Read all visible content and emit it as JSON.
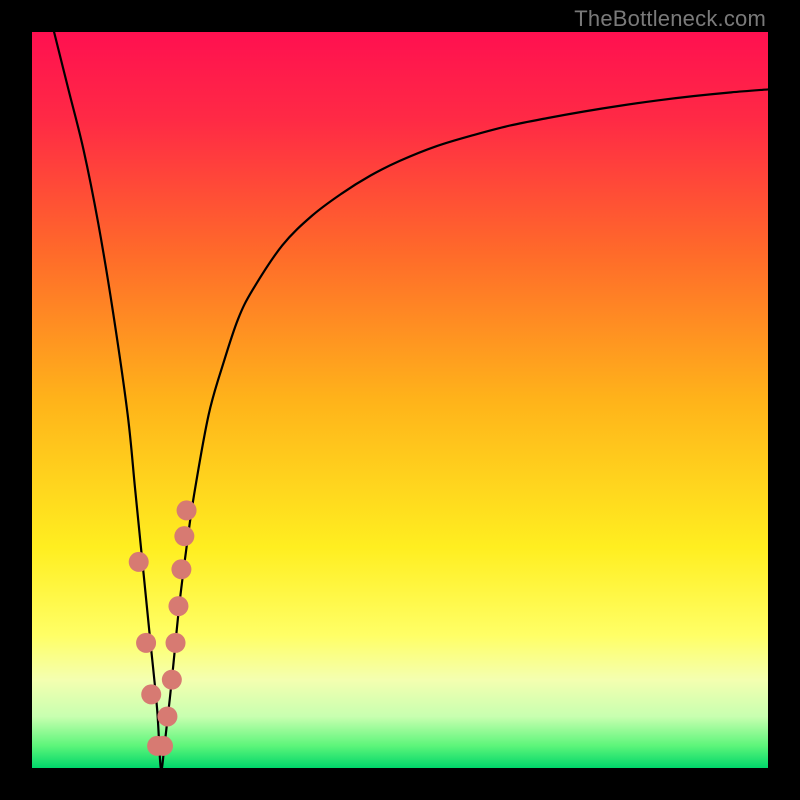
{
  "watermark": "TheBottleneck.com",
  "plot": {
    "inner_left": 32,
    "inner_top": 32,
    "inner_width": 736,
    "inner_height": 736
  },
  "colors": {
    "frame": "#000000",
    "curve": "#000000",
    "dot_fill": "#d77a72",
    "watermark": "#7a7a7a",
    "gradient_stops": [
      {
        "offset": 0.0,
        "color": "#ff1050"
      },
      {
        "offset": 0.12,
        "color": "#ff2a45"
      },
      {
        "offset": 0.3,
        "color": "#ff6a2a"
      },
      {
        "offset": 0.5,
        "color": "#ffb31a"
      },
      {
        "offset": 0.7,
        "color": "#ffee20"
      },
      {
        "offset": 0.82,
        "color": "#ffff66"
      },
      {
        "offset": 0.88,
        "color": "#f4ffb0"
      },
      {
        "offset": 0.93,
        "color": "#c8ffb0"
      },
      {
        "offset": 0.97,
        "color": "#5cf57a"
      },
      {
        "offset": 1.0,
        "color": "#00d66a"
      }
    ]
  },
  "chart_data": {
    "type": "line",
    "title": "",
    "xlabel": "",
    "ylabel": "",
    "xlim": [
      0,
      100
    ],
    "ylim": [
      0,
      100
    ],
    "x_min_at": 17.5,
    "series": [
      {
        "name": "bottleneck-curve",
        "x": [
          3,
          5,
          7,
          9,
          11,
          13,
          14,
          15,
          16,
          17,
          17.5,
          18,
          19,
          20,
          21,
          22,
          24,
          26,
          28,
          30,
          34,
          38,
          42,
          46,
          50,
          55,
          60,
          65,
          70,
          75,
          80,
          85,
          90,
          95,
          100
        ],
        "y": [
          100,
          92,
          84,
          74,
          62,
          48,
          38,
          28,
          18,
          8,
          0,
          3,
          12,
          22,
          30,
          37,
          48,
          55,
          61,
          65,
          71,
          75,
          78,
          80.5,
          82.5,
          84.5,
          86,
          87.3,
          88.3,
          89.2,
          90,
          90.7,
          91.3,
          91.8,
          92.2
        ]
      }
    ],
    "points": {
      "name": "highlighted-dots",
      "x": [
        14.5,
        15.5,
        16.2,
        17.0,
        17.8,
        18.4,
        19.0,
        19.5,
        19.9,
        20.3,
        20.7,
        21.0
      ],
      "y": [
        28.0,
        17.0,
        10.0,
        3.0,
        3.0,
        7.0,
        12.0,
        17.0,
        22.0,
        27.0,
        31.5,
        35.0
      ]
    }
  }
}
